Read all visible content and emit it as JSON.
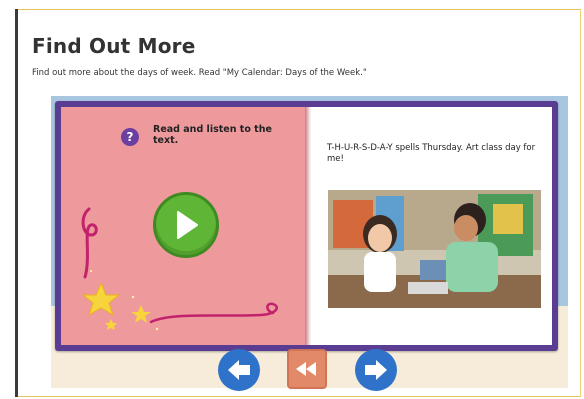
{
  "page": {
    "title": "Find Out More",
    "subtitle": "Find out more about the days of week. Read \"My Calendar: Days of the Week.\""
  },
  "book": {
    "left_page": {
      "instruction": "Read and listen to the text.",
      "help_icon": "question-icon",
      "play_icon": "play-icon"
    },
    "right_page": {
      "caption": "T-H-U-R-S-D-A-Y spells Thursday. Art class day for me!",
      "photo": "children-painting-photo"
    }
  },
  "navigation": {
    "prev_icon": "arrow-left-icon",
    "rewind_icon": "rewind-icon",
    "next_icon": "arrow-right-icon"
  },
  "colors": {
    "book_cover": "#5a3d93",
    "left_page": "#ee9a9d",
    "play_button": "#5fb535",
    "nav_button": "#2f72c9",
    "rewind_button": "#e2896a"
  }
}
